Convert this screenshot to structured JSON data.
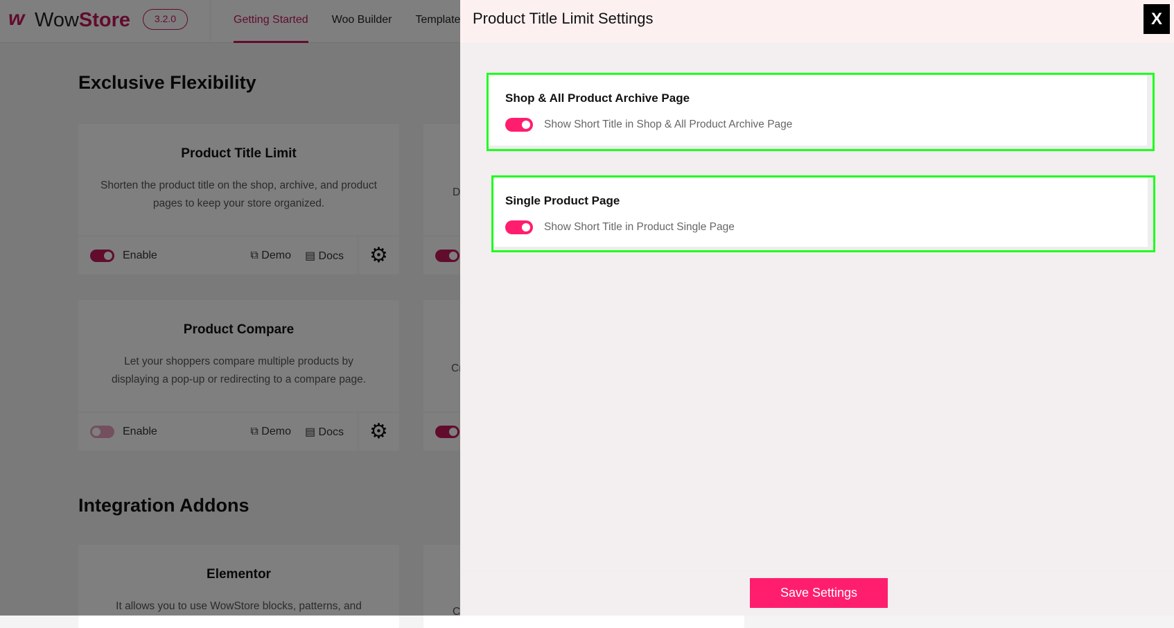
{
  "app": {
    "brand_prefix": "Wow",
    "brand_suffix": "Store",
    "version": "3.2.0",
    "nav": [
      {
        "label": "Getting Started",
        "active": true
      },
      {
        "label": "Woo Builder"
      },
      {
        "label": "Template"
      }
    ]
  },
  "sections": [
    {
      "title": "Exclusive Flexibility"
    },
    {
      "title": "Integration Addons"
    }
  ],
  "cards": [
    {
      "title": "Product Title Limit",
      "description": "Shorten the product title on the shop, archive, and product pages to keep your store organized.",
      "enable_label": "Enable",
      "enabled": true,
      "demo": "Demo",
      "docs": "Docs"
    },
    {
      "title": "Product Compare",
      "description": "Let your shoppers compare multiple products by displaying a pop-up or redirecting to a compare page.",
      "enable_label": "Enable",
      "enabled": false,
      "demo": "Demo",
      "docs": "Docs"
    },
    {
      "title": "Elementor",
      "description": "It allows you to use WowStore blocks, patterns, and"
    }
  ],
  "right_cards": [
    {
      "desc_fragment": "D",
      "enabled": true
    },
    {
      "desc_fragment": "Cr",
      "enabled": true
    },
    {
      "desc_fragment": "C"
    }
  ],
  "panel": {
    "title": "Product Title Limit Settings",
    "close_label": "X",
    "groups": [
      {
        "title": "Shop & All Product Archive Page",
        "option": "Show Short Title in Shop & All Product Archive Page",
        "enabled": true
      },
      {
        "title": "Single Product Page",
        "option": "Show Short Title in Product Single Page",
        "enabled": true
      }
    ],
    "save_label": "Save Settings"
  },
  "colors": {
    "brand": "#c2185b",
    "accent": "#ff1e6e",
    "highlight": "#1dff1d"
  }
}
